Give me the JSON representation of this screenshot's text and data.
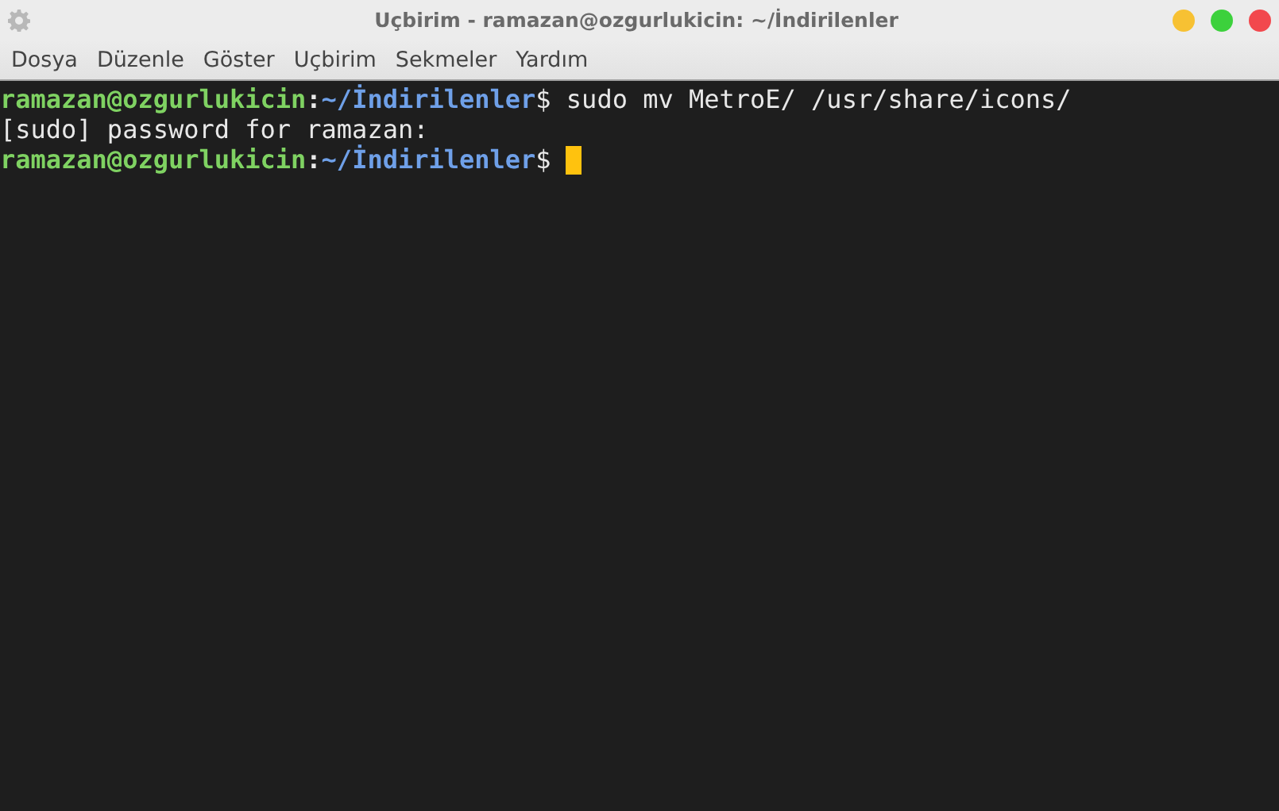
{
  "window": {
    "title": "Uçbirim - ramazan@ozgurlukicin: ~/İndirilenler"
  },
  "menu": [
    "Dosya",
    "Düzenle",
    "Göster",
    "Uçbirim",
    "Sekmeler",
    "Yardım"
  ],
  "terminal": {
    "lines": [
      [
        {
          "kind": "user",
          "text": "ramazan@ozgurlukicin"
        },
        {
          "kind": "plain_bold",
          "text": ":"
        },
        {
          "kind": "path",
          "text": "~/İndirilenler"
        },
        {
          "kind": "plain",
          "text": "$ sudo mv MetroE/ /usr/share/icons/"
        }
      ],
      [
        {
          "kind": "plain",
          "text": "[sudo] password for ramazan:"
        }
      ],
      [
        {
          "kind": "user",
          "text": "ramazan@ozgurlukicin"
        },
        {
          "kind": "plain_bold",
          "text": ":"
        },
        {
          "kind": "path",
          "text": "~/İndirilenler"
        },
        {
          "kind": "plain",
          "text": "$ "
        },
        {
          "kind": "cursor"
        }
      ]
    ]
  }
}
